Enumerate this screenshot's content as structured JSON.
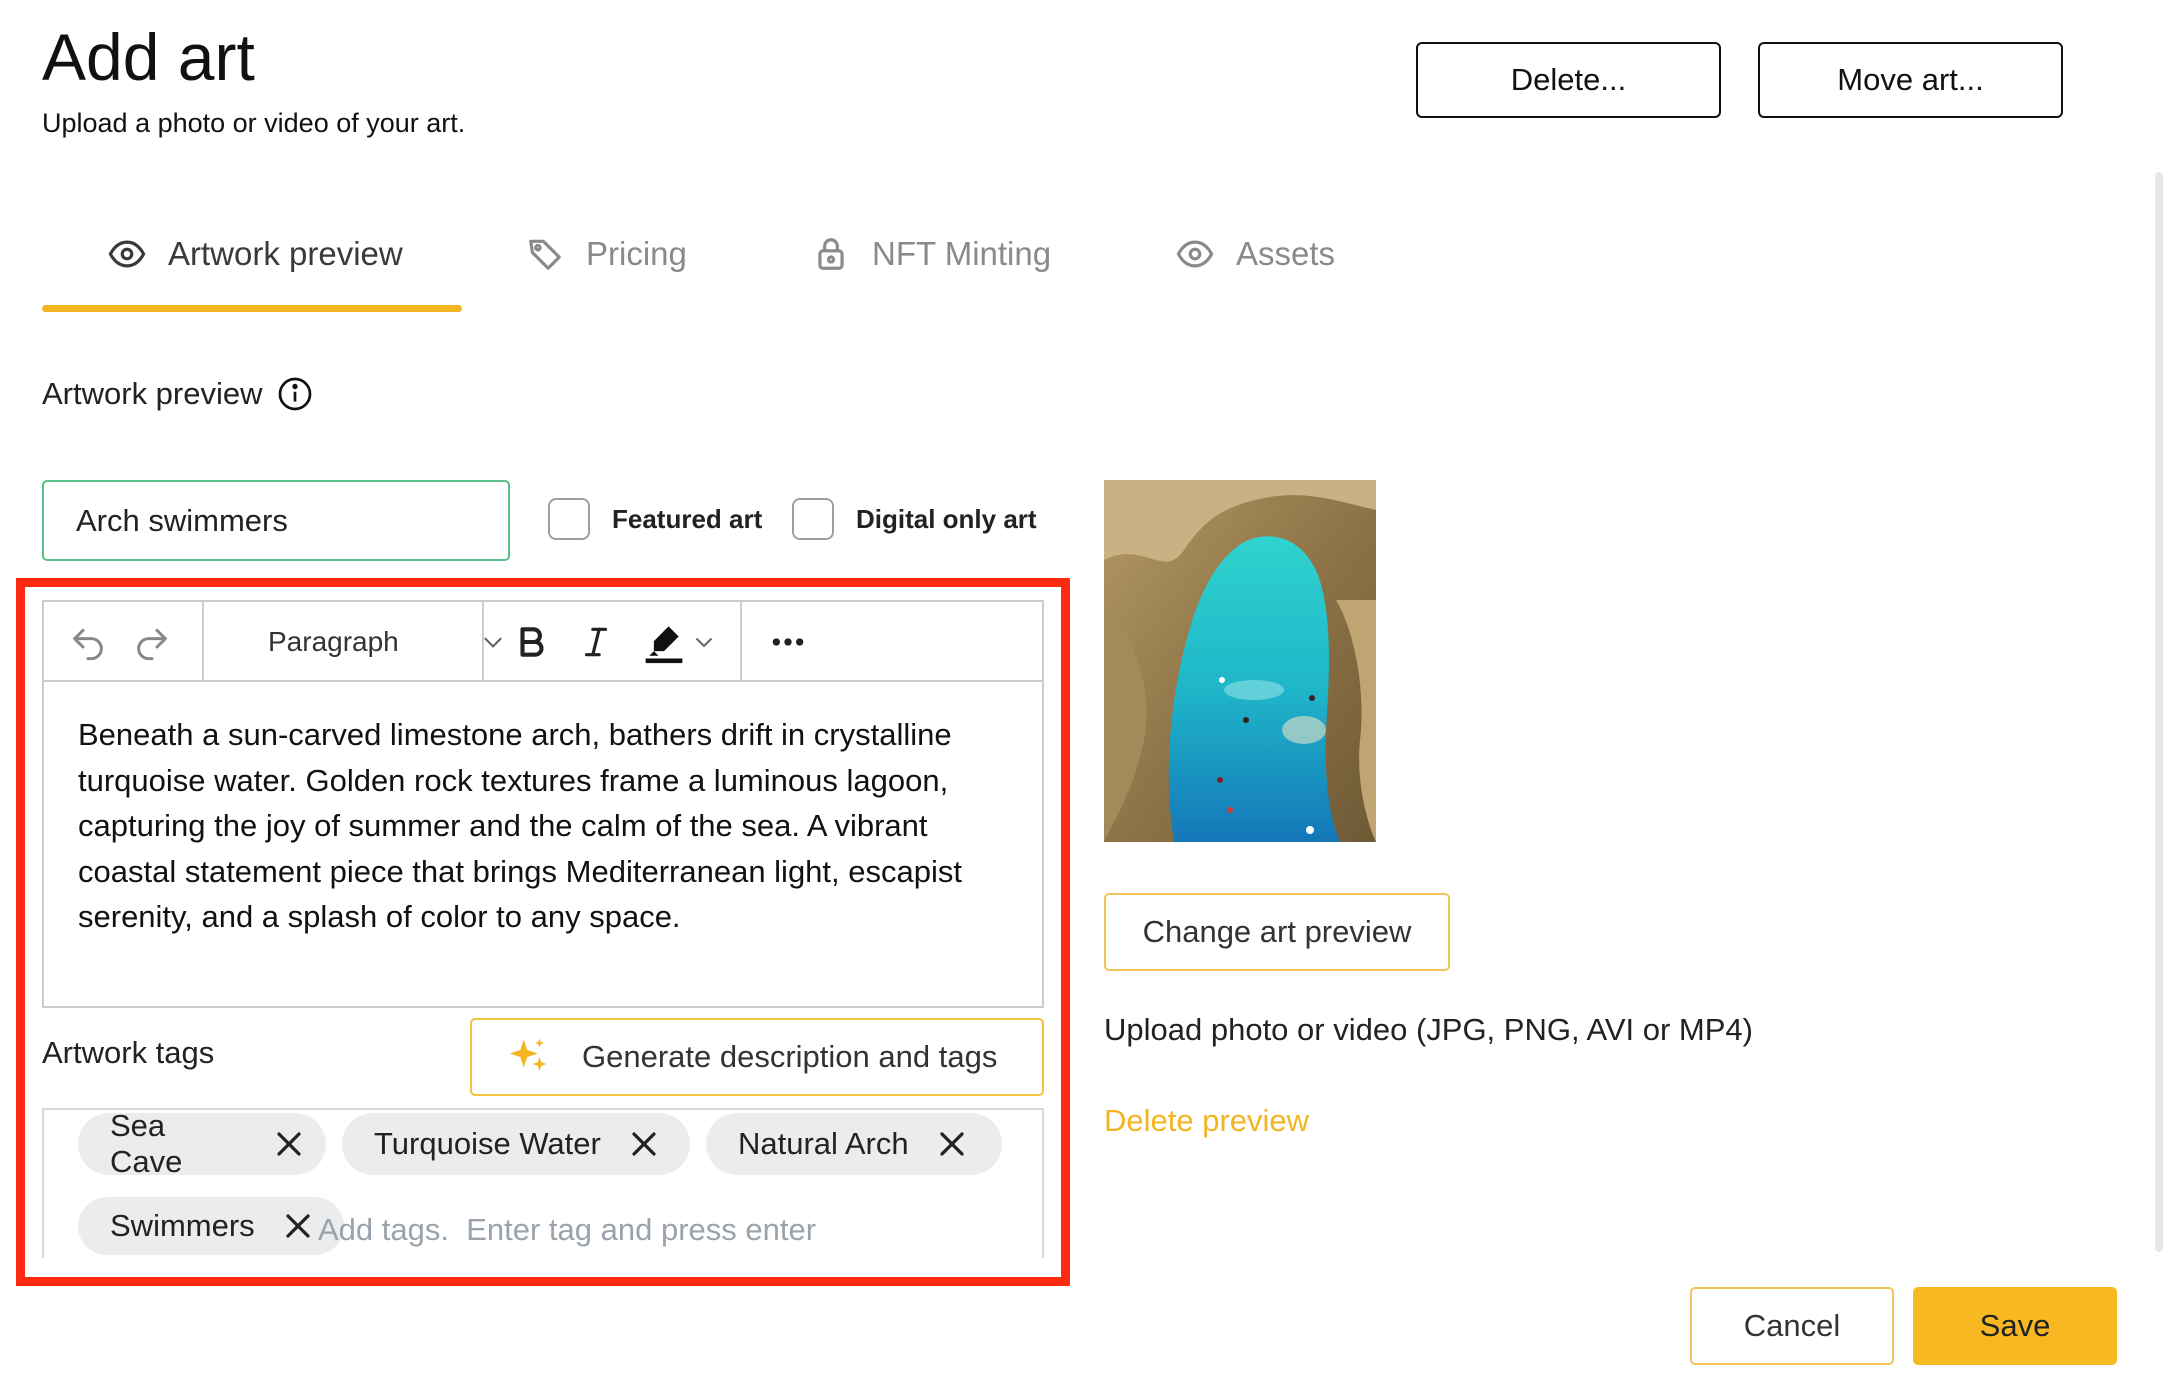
{
  "header": {
    "title": "Add art",
    "subtitle": "Upload a photo or video of your art.",
    "delete_label": "Delete...",
    "move_label": "Move art..."
  },
  "tabs": [
    {
      "label": "Artwork preview",
      "icon": "eye-icon",
      "active": true
    },
    {
      "label": "Pricing",
      "icon": "tag-icon",
      "active": false
    },
    {
      "label": "NFT Minting",
      "icon": "lock-icon",
      "active": false
    },
    {
      "label": "Assets",
      "icon": "eye-icon",
      "active": false
    }
  ],
  "section": {
    "label": "Artwork preview",
    "info_icon": "info-icon"
  },
  "form": {
    "title_value": "Arch swimmers",
    "featured_label": "Featured art",
    "featured_checked": false,
    "digital_label": "Digital only art",
    "digital_checked": false
  },
  "editor": {
    "block_format": "Paragraph",
    "toolbar_icons": [
      "undo-icon",
      "redo-icon",
      "bold-icon",
      "italic-icon",
      "highlight-icon",
      "more-icon"
    ],
    "description": "Beneath a sun-carved limestone arch, bathers drift in crystalline turquoise water. Golden rock textures frame a luminous lagoon, capturing the joy of summer and the calm of the sea. A vibrant coastal statement piece that brings Mediterranean light, escapist serenity, and a splash of color to any space."
  },
  "tags": {
    "label": "Artwork tags",
    "generate_label": "Generate description and tags",
    "items": [
      "Sea Cave",
      "Turquoise Water",
      "Natural Arch",
      "Swimmers"
    ],
    "placeholder": "Add tags.  Enter tag and press enter"
  },
  "preview": {
    "change_label": "Change art preview",
    "upload_hint": "Upload photo or video (JPG, PNG, AVI or MP4)",
    "delete_label": "Delete preview"
  },
  "footer": {
    "cancel_label": "Cancel",
    "save_label": "Save"
  },
  "colors": {
    "accent": "#f3b521",
    "save_bg": "#f8b821",
    "input_border": "#58c089",
    "highlight_frame": "#ff2a12"
  }
}
